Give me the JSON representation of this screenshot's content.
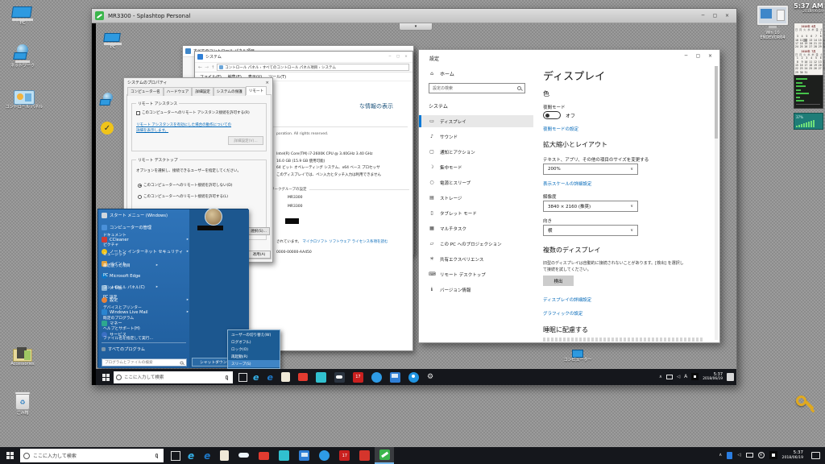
{
  "icons": {
    "minimize": "─",
    "maximize": "▢",
    "close": "×",
    "chevron_down": "▾",
    "dropdown": "∨",
    "chevron_up": "∧",
    "back": "←",
    "forward": "→",
    "up": "↑",
    "submenu_arrow": "▸",
    "home": "⌂",
    "display": "▭",
    "sound": "♪",
    "notifications": "▢",
    "focus": "☽",
    "power": "○",
    "storage": "▤",
    "tablet": "▯",
    "multitask": "▦",
    "projection": "▱",
    "share": "✳",
    "remote_desktop": "⌨",
    "about": "ℹ"
  },
  "host": {
    "desktop_icons": {
      "pc": "PC",
      "network": "ネットワーク",
      "control_panel": "コントロール パネル",
      "accessories": "Accessories",
      "recycle_bin": "ごみ箱",
      "win10": "Win 10",
      "win10b": "ENDEVOR64"
    },
    "gadgets": {
      "clock_time": "5:37 AM",
      "clock_date": "2018/06/19",
      "cal_month1": "2018年 6月",
      "cal_head": "日 月 火 水 木 金 土",
      "m1w1": "                1  2",
      "m1w2": " 3  4  5  6  7  8  9",
      "m1w3": "10 11 12 13 14 15 16",
      "m1w4": "17 18 19 20 21 22 23",
      "m1w5": "24 25 26 27 28 29 30",
      "cal_month2": "2018年 7月",
      "m2w1": " 1  2  3  4  5  6  7",
      "m2w2": " 8  9 10 11 12 13 14",
      "m2w3": "15 16 17 18 19 20 21",
      "m2w4": "22 23 24 25 26 27 28",
      "m2w5": "29 30 31",
      "meter2_value": "37%"
    },
    "taskbar": {
      "search": "ここに入力して検索",
      "time": "5:37",
      "date": "2018/06/19"
    }
  },
  "splashtop": {
    "title": "MR3300 - Splashtop Personal"
  },
  "remote": {
    "desktop_pc_label": "PC",
    "desktop_computer_label": "コンピューター",
    "allcp_title": "すべてのコントロール パネル項目",
    "system": {
      "title": "システム",
      "breadcrumb": "コントロール パネル  ›  すべてのコントロール パネル項目  ›  システム",
      "menu_file": "ファイル(F)",
      "menu_edit": "編集(E)",
      "menu_view": "表示(V)",
      "menu_tools": "ツール(T)",
      "heading_frag": "な情報の表示",
      "copyright_frag": "poration. All rights reserved.",
      "cpu": "Intel(R) Core(TM) i7-2600K CPU @ 3.40GHz   3.40 GHz",
      "ram": "16.0 GB (15.9 GB 使用可能)",
      "os": "64 ビット オペレーティング システム、x64 ベース プロセッサ",
      "pen": "このディスプレイでは、ペン入力とタッチ入力は利用できません",
      "workgroup_frag": "ワークグループの設定",
      "computer_name": "MR3300",
      "full_computer_name": "MR3300",
      "activation_frag": "されています。",
      "license_link": "マイクロソフト ソフトウェア ライセンス条項を読む",
      "product_id_frag": "0000-00000-AA450"
    },
    "sysprops": {
      "title": "システムのプロパティ",
      "tabs": [
        "コンピューター名",
        "ハードウェア",
        "詳細設定",
        "システムの保護",
        "リモート"
      ],
      "ra_group": "リモート アシスタンス",
      "ra_checkbox": "このコンピューターへのリモート アシスタンス接続を許可する(R)",
      "ra_link1": "リモート アシスタンスを有効にした場合の動作についての",
      "ra_link2": "詳細を表示します。",
      "ra_button": "詳細設定(V)...",
      "rd_group": "リモート デスクトップ",
      "rd_text": "オプションを選択し、接続できるユーザーを指定してください。",
      "rd_radio_deny": "このコンピューターへのリモート接続を許可しない(D)",
      "rd_radio_allow": "このコンピューターへのリモート接続を許可する(L)",
      "select_button_frag": "選択(S)...",
      "apply_button": "適用(A)"
    },
    "start": {
      "left": [
        "スタート メニュー (Windows)",
        "コンピューターの管理",
        "CCleaner",
        "ノートン インターネット セキュリティ",
        "ペイント",
        "Microsoft Edge",
        "メモ帳",
        "設定",
        "Windows Live Mail",
        "マネー",
        "サービス",
        "すべてのプログラム"
      ],
      "search": "プログラムとファイルの検索",
      "right": [
        "ドキュメント",
        "ピクチャ",
        "ミュージック",
        "最近使った項目",
        "PC",
        "コントロール パネル(C)",
        "PC 設定",
        "デバイスとプリンター",
        "既定のプログラム",
        "ヘルプとサポート(H)",
        "ファイル名を指定して実行..."
      ],
      "shutdown": "シャットダウン(U)",
      "power": [
        "ユーザーの切り替え(W)",
        "ログオフ(L)",
        "ロック(O)",
        "再起動(R)",
        "スリープ(S)"
      ]
    },
    "settings": {
      "title": "設定",
      "home": "ホーム",
      "search": "設定の検索",
      "section": "システム",
      "nav": [
        "ディスプレイ",
        "サウンド",
        "通知とアクション",
        "集中モード",
        "電源とスリープ",
        "ストレージ",
        "タブレット モード",
        "マルチタスク",
        "この PC へのプロジェクション",
        "共有エクスペリエンス",
        "リモート デスクトップ",
        "バージョン情報"
      ],
      "page_title": "ディスプレイ",
      "color_heading": "色",
      "night_label": "夜間モード",
      "night_state": "オフ",
      "night_link": "夜間モードの設定",
      "scale_heading": "拡大縮小とレイアウト",
      "scale_label": "テキスト、アプリ、その他の項目のサイズを変更する",
      "scale_value": "200%",
      "scale_link": "表示スケールの詳細設定",
      "res_label": "解像度",
      "res_value": "3840 × 2160 (推奨)",
      "orient_label": "向き",
      "orient_value": "横",
      "multi_heading": "複数のディスプレイ",
      "multi_text1": "旧型のディスプレイは自動的に接続されないことがあります。[検出] を選択し",
      "multi_text2": "て接続を試してください。",
      "detect_button": "検出",
      "adv_link": "ディスプレイの詳細設定",
      "gfx_link": "グラフィックの設定",
      "sleep_heading": "睡眠に配慮する"
    },
    "taskbar": {
      "search": "ここに入力して検索",
      "ime": "A",
      "time": "5:37",
      "date": "2018/06/19"
    }
  }
}
